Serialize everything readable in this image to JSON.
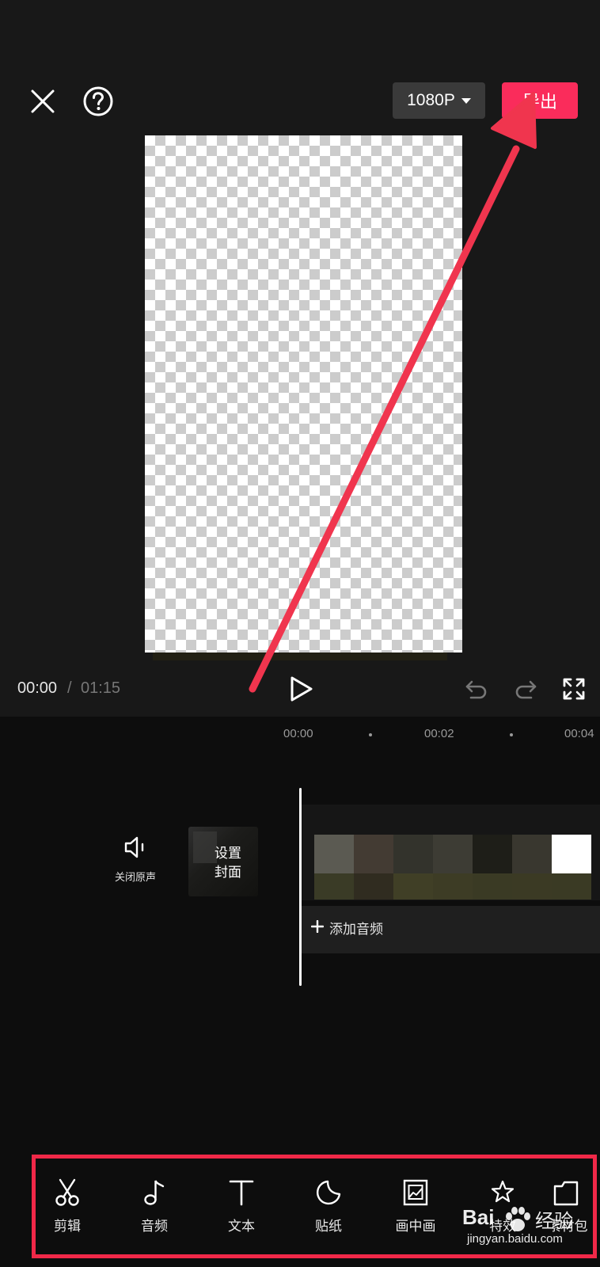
{
  "header": {
    "resolution_label": "1080P",
    "export_label": "导出",
    "close_icon": "close-icon",
    "help_icon": "help-icon",
    "caret_icon": "caret-down-icon"
  },
  "playback": {
    "current_time": "00:00",
    "separator": "/",
    "total_time": "01:15",
    "play_icon": "play-icon",
    "undo_icon": "undo-icon",
    "redo_icon": "redo-icon",
    "fullscreen_icon": "fullscreen-icon"
  },
  "timeline": {
    "ruler": [
      "00:00",
      "00:02",
      "00:04"
    ],
    "mute_label": "关闭原声",
    "mute_icon": "speaker-icon",
    "cover_label_line1": "设置",
    "cover_label_line2": "封面",
    "add_audio_label": "添加音频",
    "add_audio_icon": "plus-icon",
    "frame_colors_top": [
      "#5b5a52",
      "#433b33",
      "#33332c",
      "#3d3c34",
      "#1e1e18",
      "#39372f",
      "#ffffff"
    ],
    "frame_colors_bottom": [
      "#3a3b26",
      "#302c20",
      "#403f26",
      "#3d3c25",
      "#3a3a24",
      "#3b3a24",
      "#3a3a24"
    ]
  },
  "toolbar": {
    "items": [
      {
        "label": "剪辑",
        "icon": "scissors-icon"
      },
      {
        "label": "音频",
        "icon": "music-note-icon"
      },
      {
        "label": "文本",
        "icon": "text-icon"
      },
      {
        "label": "贴纸",
        "icon": "sticker-icon"
      },
      {
        "label": "画中画",
        "icon": "picture-in-picture-icon"
      },
      {
        "label": "特效",
        "icon": "sparkle-star-icon"
      },
      {
        "label": "素材包",
        "icon": "material-package-icon"
      }
    ]
  },
  "annotation": {
    "color": "#f0354e"
  },
  "watermark": {
    "brand": "Bai",
    "brand_suffix": "经验",
    "url": "jingyan.baidu.com"
  },
  "colors": {
    "accent": "#fa2c5b",
    "background": "#181818",
    "highlight": "#f02848"
  }
}
